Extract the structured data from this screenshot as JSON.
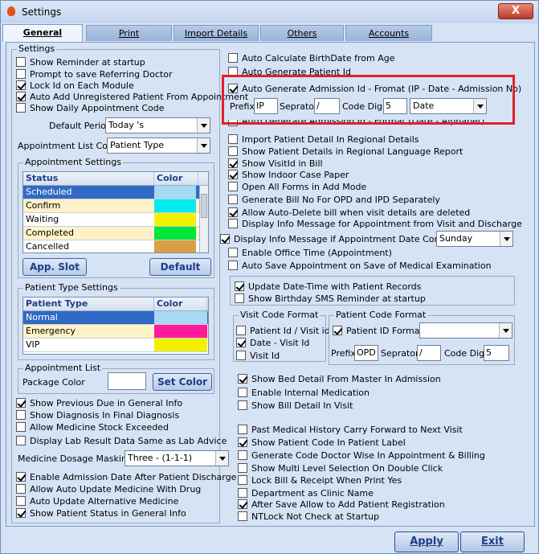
{
  "window": {
    "title": "Settings",
    "close": "X"
  },
  "tabs": [
    "General",
    "Print",
    "Import Details",
    "Others",
    "Accounts"
  ],
  "left": {
    "settings_legend": "Settings",
    "checks": [
      {
        "label": "Show Reminder at startup",
        "checked": false
      },
      {
        "label": "Prompt to save Referring Doctor",
        "checked": false
      },
      {
        "label": "Lock Id on Each Module",
        "checked": true
      },
      {
        "label": "Auto Add Unregistered Patient From Appointment",
        "checked": true
      },
      {
        "label": "Show Daily Appointment Code",
        "checked": false
      }
    ],
    "default_period_label": "Default Period",
    "default_period_value": "Today 's",
    "appt_color_label": "Appointment List Color",
    "appt_color_value": "Patient Type",
    "appt_settings": {
      "legend": "Appointment Settings",
      "col_status": "Status",
      "col_color": "Color",
      "rows": [
        {
          "status": "Scheduled",
          "color": "#a6d9f2",
          "bg": "#316ac5",
          "fg": "#ffffff"
        },
        {
          "status": "Confirm",
          "color": "#00ecf2",
          "bg": "#fff2c8",
          "fg": "#000000"
        },
        {
          "status": "Waiting",
          "color": "#f2f200",
          "bg": "#ffffff",
          "fg": "#000000"
        },
        {
          "status": "Completed",
          "color": "#00e63a",
          "bg": "#fff2c8",
          "fg": "#000000"
        },
        {
          "status": "Cancelled",
          "color": "#d9a045",
          "bg": "#ffffff",
          "fg": "#000000"
        }
      ],
      "btn_slot": "App. Slot",
      "btn_default": "Default"
    },
    "patient_type": {
      "legend": "Patient Type Settings",
      "col_type": "Patient Type",
      "col_color": "Color",
      "rows": [
        {
          "type": "Normal",
          "color": "#a6d9f2",
          "bg": "#316ac5",
          "fg": "#ffffff"
        },
        {
          "type": "Emergency",
          "color": "#ff1a9c",
          "bg": "#fff2c8",
          "fg": "#000000"
        },
        {
          "type": "VIP",
          "color": "#f2f200",
          "bg": "#ffffff",
          "fg": "#000000"
        }
      ]
    },
    "appt_list": {
      "legend": "Appointment List",
      "package_color_label": "Package Color",
      "btn_set_color": "Set Color"
    },
    "checks2": [
      {
        "label": "Show Previous Due in General Info",
        "checked": true
      },
      {
        "label": "Show Diagnosis In Final Diagnosis",
        "checked": false
      },
      {
        "label": "Allow Medicine Stock Exceeded",
        "checked": false
      },
      {
        "label": "Display Lab Result Data Same as Lab Advice",
        "checked": false
      }
    ],
    "dosage_label": "Medicine Dosage Masking",
    "dosage_value": "Three - (1-1-1)",
    "checks3": [
      {
        "label": "Enable Admission Date After Patient Discharge",
        "checked": true
      },
      {
        "label": "Allow Auto Update Medicine With Drug",
        "checked": false
      },
      {
        "label": "Auto Update Alternative Medicine",
        "checked": false
      },
      {
        "label": "Show Patient Status in General Info",
        "checked": true
      }
    ]
  },
  "right": {
    "checks_top": [
      {
        "label": "Auto Calculate BirthDate from Age",
        "checked": false
      },
      {
        "label": "Auto Generate Patient Id",
        "checked": false
      }
    ],
    "admission": {
      "label": "Auto Generate Admission Id  - Fromat (IP - Date - Admission No)",
      "checked": true,
      "prefix_label": "Prefix",
      "prefix_value": "IP",
      "separator_label": "Seprator",
      "separator_value": "/",
      "code_digit_label": "Code Digit",
      "code_digit_value": "5",
      "format_value": "Date"
    },
    "hidden_label": "Auto Generate Admission Id - Format (Date - Alphabet)",
    "checks_mid": [
      {
        "label": "Import Patient Detail In Regional Details",
        "checked": false
      },
      {
        "label": "Show Patient Details in Regional Language Report",
        "checked": false
      },
      {
        "label": "Show VisitId in Bill",
        "checked": true
      },
      {
        "label": "Show Indoor Case Paper",
        "checked": true
      },
      {
        "label": "Open All Forms in Add Mode",
        "checked": false
      },
      {
        "label": "Generate Bill No For OPD and IPD Separately",
        "checked": false
      },
      {
        "label": "Allow Auto-Delete bill when visit details are deleted",
        "checked": true
      },
      {
        "label": "Display Info Message for Appointment from Visit and Discharge",
        "checked": false
      }
    ],
    "info_msg_label": "Display Info Message if Appointment Date Comes on",
    "info_msg_checked": true,
    "info_msg_day": "Sunday",
    "checks_mid2": [
      {
        "label": "Enable Office Time (Appointment)",
        "checked": false
      },
      {
        "label": "Auto Save Appointment on Save of Medical Examination",
        "checked": false
      }
    ],
    "group_update": [
      {
        "label": "Update Date-Time with Patient Records",
        "checked": true
      },
      {
        "label": "Show Birthday SMS Reminder at startup",
        "checked": false
      }
    ],
    "visit_code": {
      "legend": "Visit Code Format",
      "items": [
        {
          "label": "Patient Id / Visit id",
          "checked": false
        },
        {
          "label": "Date - Visit Id",
          "checked": true
        },
        {
          "label": "Visit Id",
          "checked": false
        }
      ]
    },
    "patient_code": {
      "legend": "Patient Code Format",
      "id_format_label": "Patient ID Format",
      "id_format_checked": true,
      "prefix_label": "Prefix",
      "prefix_value": "OPD",
      "separator_label": "Seprator",
      "separator_value": "/",
      "code_digit_label": "Code Digit",
      "code_digit_value": "5"
    },
    "checks_bed": [
      {
        "label": "Show Bed Detail From Master In Admission",
        "checked": true
      },
      {
        "label": "Enable Internal Medication",
        "checked": false
      },
      {
        "label": "Show Bill Detail In Visit",
        "checked": false
      }
    ],
    "checks_bottom": [
      {
        "label": "Past Medical History Carry Forward to Next Visit",
        "checked": false
      },
      {
        "label": "Show Patient Code In Patient Label",
        "checked": true
      },
      {
        "label": "Generate Code Doctor Wise In Appointment & Billing",
        "checked": false
      },
      {
        "label": "Show Multi Level Selection On Double Click",
        "checked": false
      },
      {
        "label": "Lock Bill & Receipt When Print Yes",
        "checked": false
      },
      {
        "label": "Department as Clinic Name",
        "checked": false
      },
      {
        "label": "After Save Allow to Add Patient Registration",
        "checked": true
      },
      {
        "label": "NTLock Not Check at Startup",
        "checked": false
      }
    ]
  },
  "footer": {
    "apply": "Apply",
    "exit": "Exit"
  }
}
